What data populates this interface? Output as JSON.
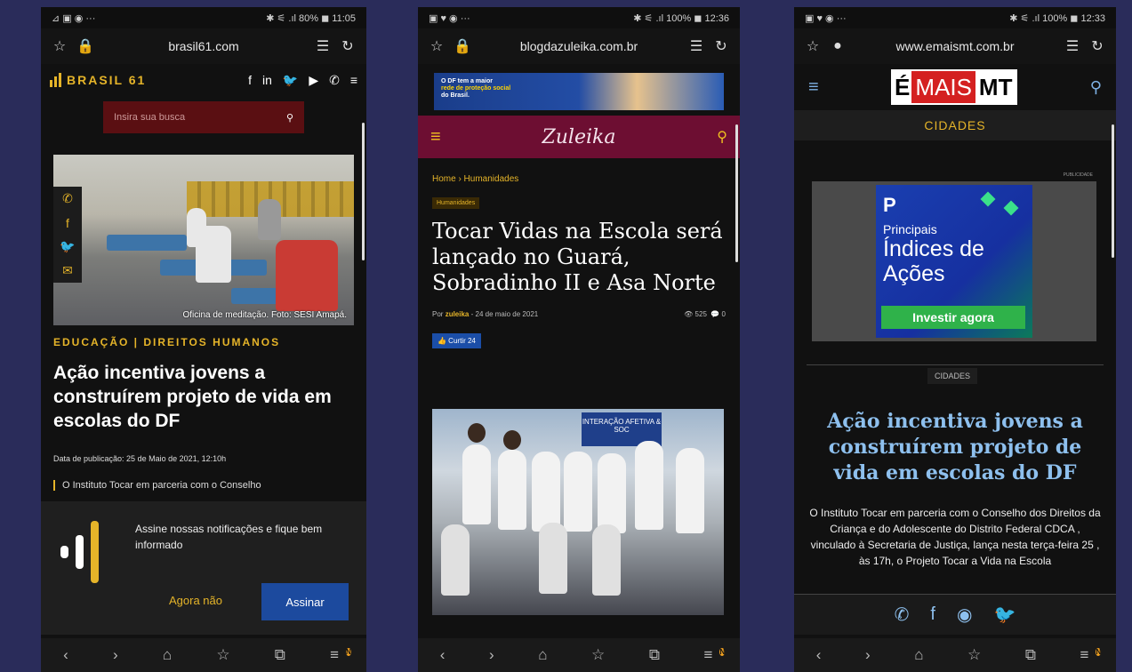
{
  "phones": [
    {
      "status": {
        "left": "⊿ ▣ ◉ ···",
        "right": "✱ ⚟ .ıl 80% ◼ 11:05"
      },
      "url": "brasil61.com",
      "logo": "BRASIL 61",
      "search_placeholder": "Insira sua busca",
      "photo_caption": "Oficina de meditação. Foto: SESI Amapá.",
      "category": "EDUCAÇÃO | DIREITOS HUMANOS",
      "title": "Ação incentiva jovens a construírem projeto de vida em escolas do DF",
      "date": "Data de publicação: 25 de Maio de 2021, 12:10h",
      "quote": "O Instituto Tocar em parceria com o Conselho",
      "notification": {
        "message": "Assine nossas notificações e fique bem informado",
        "decline": "Agora não",
        "accept": "Assinar"
      }
    },
    {
      "status": {
        "left": "▣ ♥ ◉ ···",
        "right": "✱ ⚟ .ıl 100% ◼ 12:36"
      },
      "url": "blogdazuleika.com.br",
      "banner": {
        "line1": "O DF tem a maior",
        "line2": "rede de proteção social",
        "line3": "do Brasil."
      },
      "logo": "Zuleika",
      "breadcrumb": "Home › Humanidades",
      "tag": "Humanidades",
      "title": "Tocar Vidas na Escola será lançado no Guará, Sobradinho II e Asa Norte",
      "meta": {
        "author_prefix": "Por",
        "author": "zuleika",
        "date": "- 24 de maio de 2021",
        "views": "👁 525",
        "comments": "💬 0"
      },
      "like": "👍 Curtir 24",
      "photo_banner": "INTERAÇÃO AFETIVA & SOC"
    },
    {
      "status": {
        "left": "▣ ♥ ◉ ···",
        "right": "✱ ⚟ .ıl 100% ◼ 12:33"
      },
      "url": "www.emaismt.com.br",
      "logo": {
        "e": "É",
        "mais": "MAIS",
        "mt": "MT"
      },
      "section": "CIDADES",
      "ad": {
        "pub": "PUBLICIDADE",
        "line1": "Principais",
        "line2": "Índices de Ações",
        "button": "Investir agora"
      },
      "tag": "CIDADES",
      "title": "Ação incentiva jovens a construírem projeto de vida em escolas do DF",
      "body": "O Instituto Tocar em parceria com o Conselho dos Direitos da Criança e do Adolescente do Distrito Federal CDCA , vinculado à Secretaria de Justiça, lança nesta terça-feira 25 , às 17h, o Projeto Tocar a Vida na Escola"
    }
  ],
  "navbar": {
    "back": "‹",
    "forward": "›",
    "home": "⌂",
    "bookmarks": "☆",
    "tabs": "⧉",
    "menu": "≡",
    "badge": "N"
  },
  "icons": {
    "star": "star-icon",
    "lock": "lock-icon",
    "reader": "reader-mode-icon",
    "reload": "reload-icon"
  },
  "colors": {
    "brasil61_gold": "#e5b429",
    "zuleika_header": "#6d0e32",
    "emais_blue": "#8ec0ee",
    "assinar_button": "#1c4a9e"
  }
}
